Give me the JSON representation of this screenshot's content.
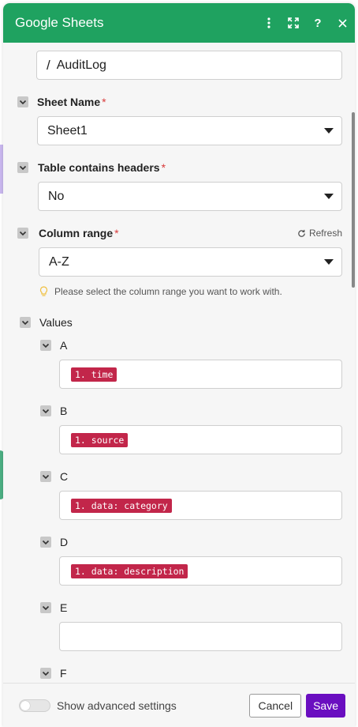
{
  "header": {
    "title": "Google Sheets"
  },
  "spreadsheet": {
    "value": "AuditLog",
    "icon": "slash-path-icon"
  },
  "sheet_name": {
    "label": "Sheet Name",
    "required_mark": "*",
    "value": "Sheet1"
  },
  "table_headers": {
    "label": "Table contains headers",
    "required_mark": "*",
    "value": "No"
  },
  "column_range": {
    "label": "Column range",
    "required_mark": "*",
    "refresh_label": "Refresh",
    "value": "A-Z",
    "hint": "Please select the column range you want to work with."
  },
  "values": {
    "label": "Values",
    "columns": [
      {
        "letter": "A",
        "pill": "1. time"
      },
      {
        "letter": "B",
        "pill": "1. source"
      },
      {
        "letter": "C",
        "pill": "1. data: category"
      },
      {
        "letter": "D",
        "pill": "1. data: description"
      },
      {
        "letter": "E",
        "pill": ""
      },
      {
        "letter": "F",
        "pill": ""
      }
    ]
  },
  "footer": {
    "advanced_label": "Show advanced settings",
    "cancel_label": "Cancel",
    "save_label": "Save"
  },
  "colors": {
    "header_green": "#1fa260",
    "pill_red": "#c2264a",
    "save_purple": "#6a0ec0",
    "required_red": "#d93b3b"
  }
}
